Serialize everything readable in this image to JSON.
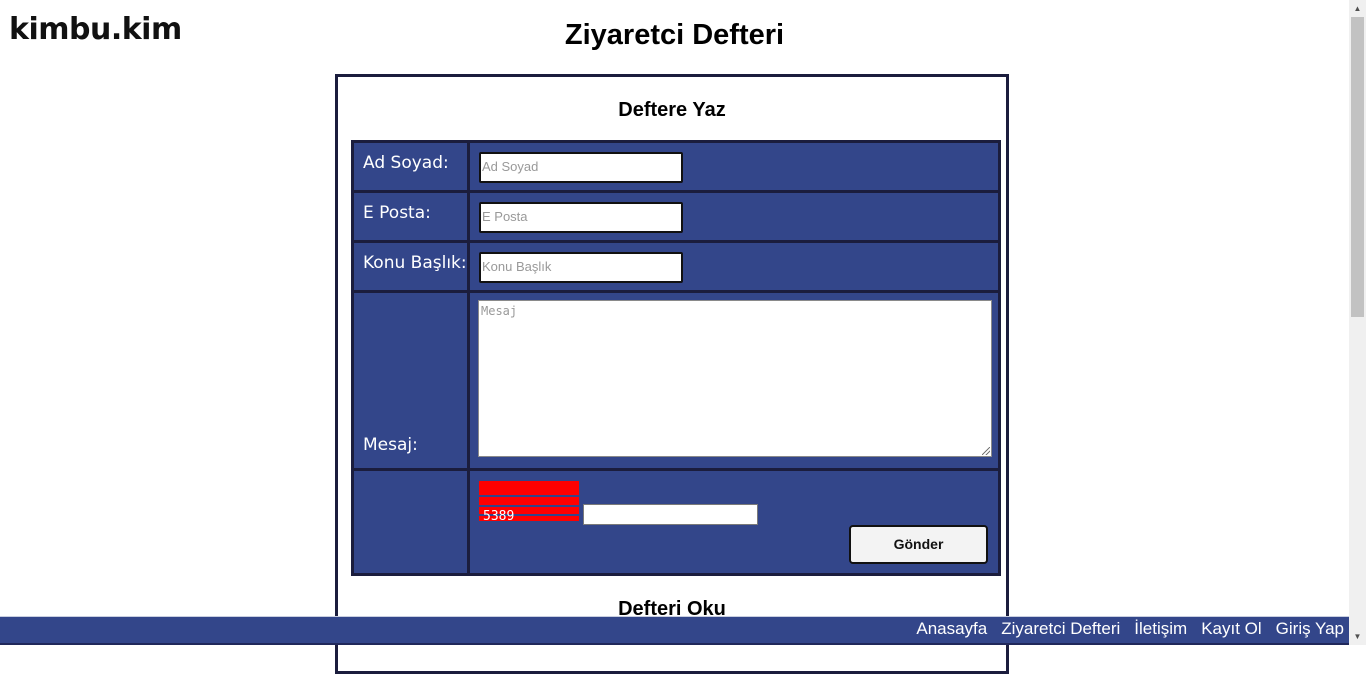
{
  "logo": "kimbu.kim",
  "page_title": "Ziyaretci Defteri",
  "write_section": {
    "heading": "Deftere Yaz"
  },
  "read_section": {
    "heading": "Defteri Oku"
  },
  "form": {
    "name_label": "Ad Soyad:",
    "name_placeholder": "Ad Soyad",
    "name_value": "",
    "email_label": "E Posta:",
    "email_placeholder": "E Posta",
    "email_value": "",
    "subject_label": "Konu Başlık:",
    "subject_placeholder": "Konu Başlık",
    "subject_value": "",
    "message_label": "Mesaj:",
    "message_placeholder": "Mesaj",
    "message_value": "",
    "captcha_code": "5389",
    "captcha_value": "",
    "submit_label": "Gönder"
  },
  "nav": {
    "home": "Anasayfa",
    "guestbook": "Ziyaretci Defteri",
    "contact": "İletişim",
    "register": "Kayıt Ol",
    "login": "Giriş Yap"
  },
  "colors": {
    "form_background": "#33468a",
    "footer_background": "#33468a",
    "captcha_color": "#ff0000",
    "border_dark": "#1b1d3d"
  },
  "icons": {
    "scroll_up": "triangle-up-icon",
    "scroll_down": "triangle-down-icon"
  }
}
